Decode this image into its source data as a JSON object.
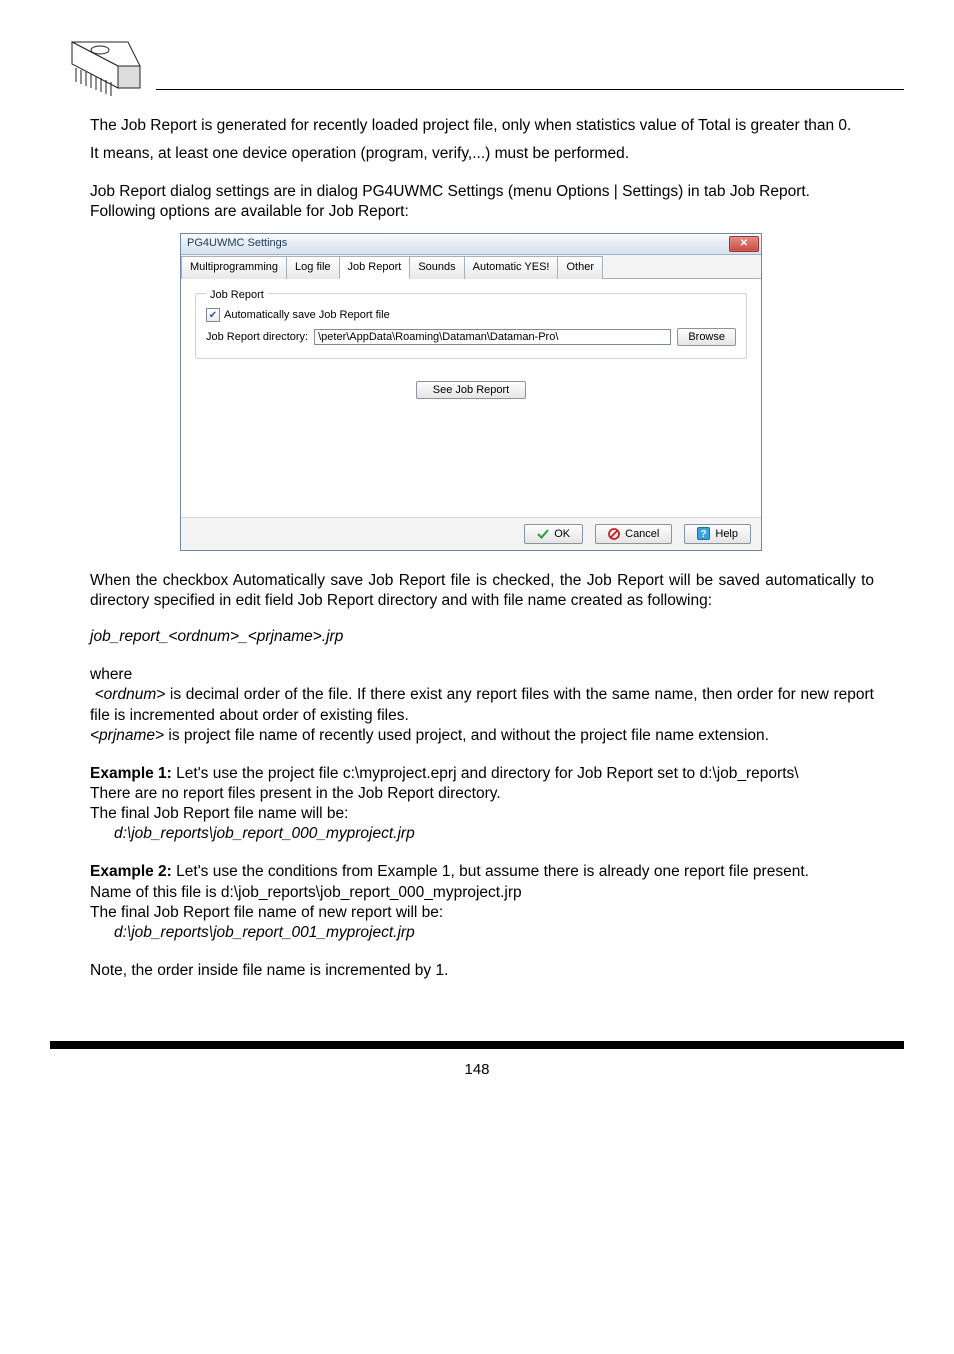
{
  "intro": {
    "p1": "The Job Report is generated for recently loaded project file, only when statistics value of Total is greater than 0.",
    "p2": "It means, at least one device operation (program, verify,...) must be performed.",
    "p3": "Job Report dialog settings are in dialog PG4UWMC Settings (menu Options | Settings) in tab Job Report.",
    "p4": "Following options are available for Job Report:"
  },
  "dialog": {
    "title": "PG4UWMC Settings",
    "tabs": [
      "Multiprogramming",
      "Log file",
      "Job Report",
      "Sounds",
      "Automatic YES!",
      "Other"
    ],
    "active_tab_index": 2,
    "group_title": "Job Report",
    "auto_save_label": "Automatically save Job Report file",
    "auto_save_checked": true,
    "dir_label": "Job Report directory:",
    "dir_value": "\\peter\\AppData\\Roaming\\Dataman\\Dataman-Pro\\",
    "browse_label": "Browse",
    "see_report_label": "See Job Report",
    "ok_label": "OK",
    "cancel_label": "Cancel",
    "help_label": "Help"
  },
  "after": {
    "p5": "When the checkbox Automatically save Job Report file is checked, the Job Report will be saved automatically to directory specified in edit field Job Report directory and with file name created as following:",
    "filename_pattern": " job_report_<ordnum>_<prjname>.jrp",
    "where": "where",
    "ordnum_line": " <ordnum> is decimal order of the file. If there exist any report files with the same name, then order for new report file is incremented about order of existing files.",
    "prjname_line": "<prjname> is project file name of recently used project, and without the project file name extension.",
    "ex1_label": "Example 1:",
    "ex1_rest": " Let's use the project file c:\\myproject.eprj and directory for Job Report set to d:\\job_reports\\",
    "ex1_l2": "There are no report files present in the Job Report directory.",
    "ex1_l3": "The final Job Report file name will be:",
    "ex1_path": "d:\\job_reports\\job_report_000_myproject.jrp",
    "ex2_label": "Example 2:",
    "ex2_rest": " Let's use the conditions from Example 1, but assume there is already one report file present.",
    "ex2_l2": "Name of this file is d:\\job_reports\\job_report_000_myproject.jrp",
    "ex2_l3": "The final Job Report file name of new report will be:",
    "ex2_path": "d:\\job_reports\\job_report_001_myproject.jrp",
    "note": "Note, the order inside file name is incremented by 1."
  },
  "page_number": "148"
}
